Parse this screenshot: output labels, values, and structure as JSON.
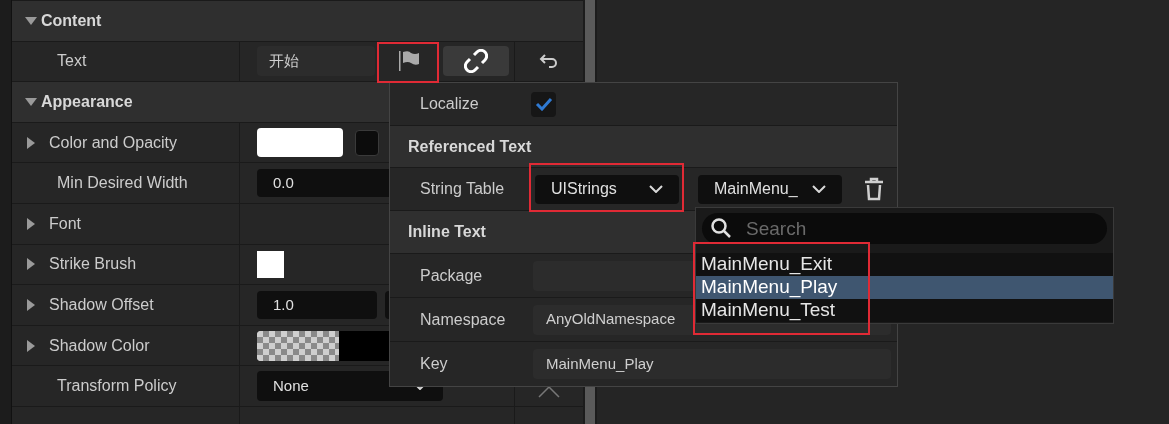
{
  "details": {
    "rows": [
      {
        "kind": "section",
        "label": "Content",
        "expanded": true
      },
      {
        "kind": "property",
        "label": "Text",
        "value": {
          "kind": "text",
          "text": "开始"
        }
      },
      {
        "kind": "section",
        "label": "Appearance",
        "expanded": true
      },
      {
        "kind": "property",
        "label": "Color and Opacity",
        "expanded": false,
        "value": {
          "kind": "color"
        }
      },
      {
        "kind": "property",
        "label": "Min Desired Width",
        "value": {
          "kind": "number",
          "text": "0.0"
        }
      },
      {
        "kind": "property",
        "label": "Font",
        "expanded": false
      },
      {
        "kind": "property",
        "label": "Strike Brush",
        "expanded": false,
        "value": {
          "kind": "swatch"
        }
      },
      {
        "kind": "property",
        "label": "Shadow Offset",
        "expanded": false,
        "value": {
          "kind": "vector",
          "text": "1.0"
        }
      },
      {
        "kind": "property",
        "label": "Shadow Color",
        "expanded": false,
        "value": {
          "kind": "checker"
        }
      },
      {
        "kind": "property",
        "label": "Transform Policy",
        "value": {
          "kind": "dropdown",
          "text": "None"
        }
      },
      {
        "kind": "property",
        "value": {
          "kind": "segmented"
        }
      }
    ]
  },
  "text_menu": {
    "localize": {
      "label": "Localize",
      "checked": true
    },
    "referenced_text": {
      "title": "Referenced Text",
      "string_table": {
        "label": "String Table",
        "table": "UIStrings",
        "key": "MainMenu_"
      }
    },
    "inline_text": {
      "title": "Inline Text",
      "fields": [
        {
          "label": "Package"
        },
        {
          "label": "Namespace",
          "value": "AnyOldNamespace"
        },
        {
          "label": "Key",
          "value": "MainMenu_Play"
        }
      ]
    }
  },
  "key_list": {
    "search": {
      "placeholder": "Search"
    },
    "items": [
      {
        "label": "MainMenu_Exit",
        "selected": false
      },
      {
        "label": "MainMenu_Play",
        "selected": true
      },
      {
        "label": "MainMenu_Test",
        "selected": false
      }
    ]
  }
}
